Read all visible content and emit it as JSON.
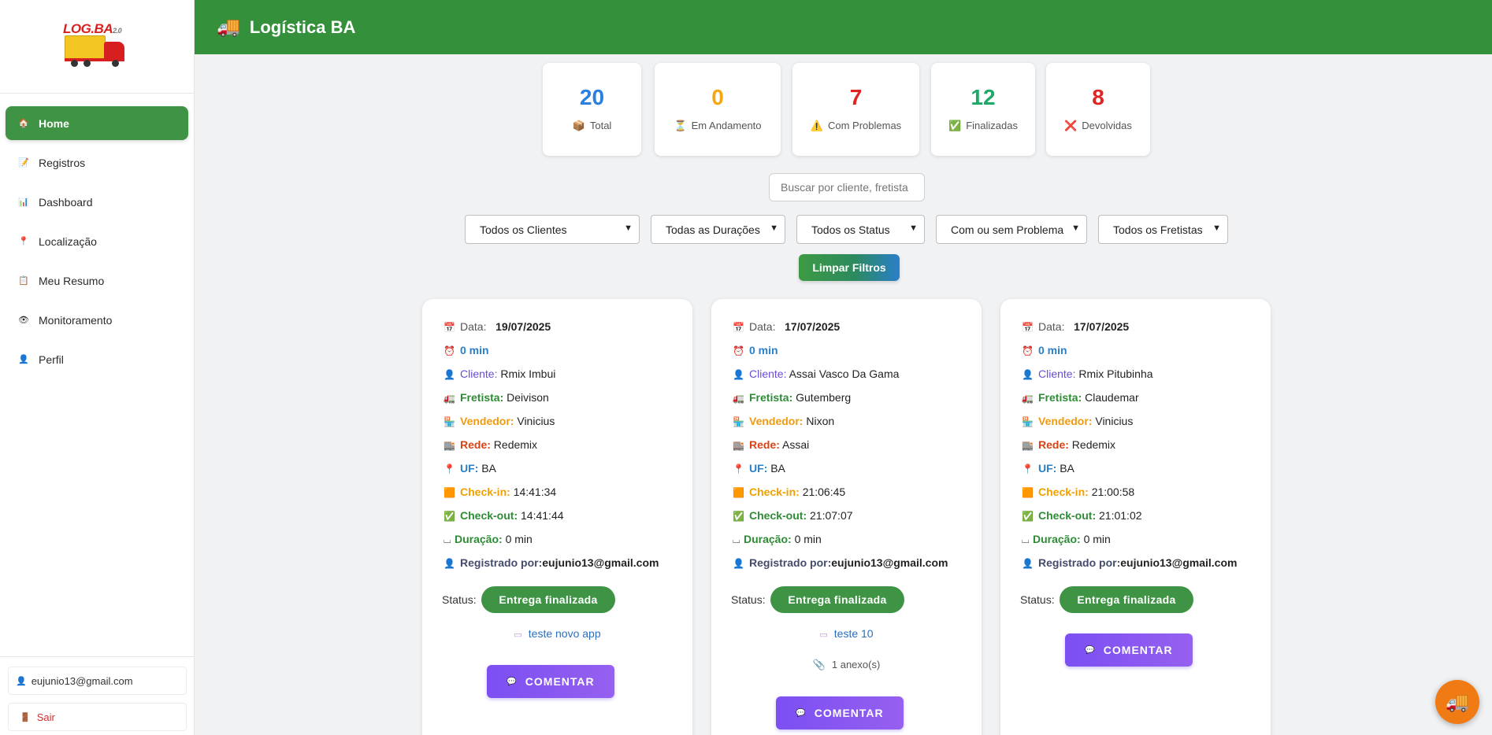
{
  "header": {
    "title": "Logística BA",
    "icon": "truck-icon"
  },
  "logo": {
    "text": "LOG.BA",
    "sup": "2.0"
  },
  "sidebar": {
    "items": [
      {
        "label": "Home",
        "icon": "house-icon",
        "active": true
      },
      {
        "label": "Registros",
        "icon": "memo-icon"
      },
      {
        "label": "Dashboard",
        "icon": "bar-chart-icon"
      },
      {
        "label": "Localização",
        "icon": "pin-icon"
      },
      {
        "label": "Meu Resumo",
        "icon": "clipboard-icon"
      },
      {
        "label": "Monitoramento",
        "icon": "eye-icon"
      },
      {
        "label": "Perfil",
        "icon": "user-icon"
      }
    ],
    "user_email": "eujunio13@gmail.com",
    "logout_label": "Sair"
  },
  "stats": [
    {
      "value": "20",
      "label": "Total",
      "color": "#2a7fe0",
      "icon": "package-icon"
    },
    {
      "value": "0",
      "label": "Em Andamento",
      "color": "#f3a712",
      "icon": "hourglass-icon"
    },
    {
      "value": "7",
      "label": "Com Problemas",
      "color": "#e02424",
      "icon": "warning-icon"
    },
    {
      "value": "12",
      "label": "Finalizadas",
      "color": "#1fa968",
      "icon": "check-icon"
    },
    {
      "value": "8",
      "label": "Devolvidas",
      "color": "#e02424",
      "icon": "cross-icon"
    }
  ],
  "search": {
    "placeholder": "Buscar por cliente, fretista"
  },
  "filters": [
    {
      "value": "Todos os Clientes"
    },
    {
      "value": "Todas as Durações"
    },
    {
      "value": "Todos os Status"
    },
    {
      "value": "Com ou sem Problema"
    },
    {
      "value": "Todos os Fretistas"
    }
  ],
  "clear_filters_label": "Limpar Filtros",
  "labels": {
    "data": "Data:",
    "cliente": "Cliente:",
    "fretista": "Fretista:",
    "vendedor": "Vendedor:",
    "rede": "Rede:",
    "uf": "UF:",
    "checkin": "Check-in:",
    "checkout": "Check-out:",
    "duracao": "Duração:",
    "registrado_por": "Registrado por:",
    "status": "Status:",
    "comentar": "COMENTAR"
  },
  "cards": [
    {
      "data": "19/07/2025",
      "tempo": "0 min",
      "cliente": "Rmix Imbui",
      "fretista": "Deivison",
      "vendedor": "Vinicius",
      "rede": "Redemix",
      "uf": "BA",
      "checkin": "14:41:34",
      "checkout": "14:41:44",
      "duracao": "0 min",
      "registrado_por": "eujunio13@gmail.com",
      "status": "Entrega finalizada",
      "comentario": "teste novo app"
    },
    {
      "data": "17/07/2025",
      "tempo": "0 min",
      "cliente": "Assai Vasco Da Gama",
      "fretista": "Gutemberg",
      "vendedor": "Nixon",
      "rede": "Assai",
      "uf": "BA",
      "checkin": "21:06:45",
      "checkout": "21:07:07",
      "duracao": "0 min",
      "registrado_por": "eujunio13@gmail.com",
      "status": "Entrega finalizada",
      "comentario": "teste 10",
      "anexos": "1 anexo(s)"
    },
    {
      "data": "17/07/2025",
      "tempo": "0 min",
      "cliente": "Rmix Pitubinha",
      "fretista": "Claudemar",
      "vendedor": "Vinicius",
      "rede": "Redemix",
      "uf": "BA",
      "checkin": "21:00:58",
      "checkout": "21:01:02",
      "duracao": "0 min",
      "registrado_por": "eujunio13@gmail.com",
      "status": "Entrega finalizada"
    }
  ],
  "fab": {
    "icon": "truck-icon"
  }
}
